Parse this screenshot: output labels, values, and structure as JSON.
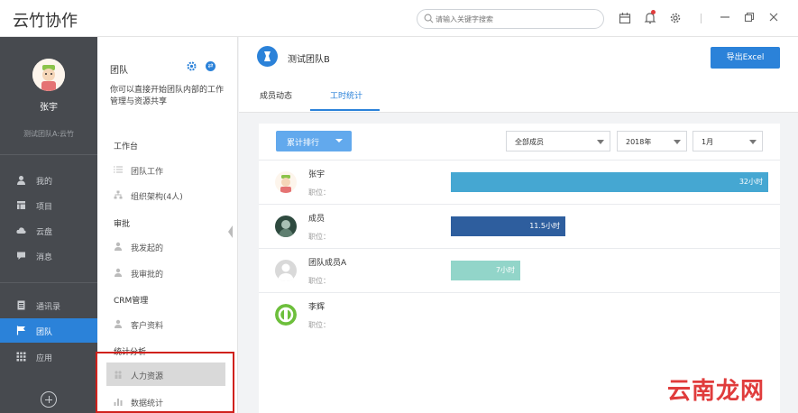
{
  "app": {
    "title": "云竹协作"
  },
  "search": {
    "placeholder": "请输入关键字搜索"
  },
  "sidebar": {
    "user_name": "张宇",
    "org_name": "测试团队A:云竹",
    "items": [
      {
        "label": "我的",
        "icon": "user-icon"
      },
      {
        "label": "项目",
        "icon": "project-icon"
      },
      {
        "label": "云盘",
        "icon": "cloud-icon"
      },
      {
        "label": "消息",
        "icon": "message-icon"
      },
      {
        "label": "通讯录",
        "icon": "contacts-icon"
      },
      {
        "label": "团队",
        "icon": "flag-icon"
      },
      {
        "label": "应用",
        "icon": "apps-grid-icon"
      }
    ]
  },
  "panel": {
    "title": "团队",
    "description": "你可以直接开始团队内部的工作管理与资源共享",
    "sections": {
      "workbench": "工作台",
      "approval": "审批",
      "crm": "CRM管理",
      "stats": "统计分析"
    },
    "items": {
      "team_work": "团队工作",
      "org": "组织架构(4人)",
      "initiated": "我发起的",
      "approved": "我审批的",
      "customers": "客户资料",
      "hr": "人力资源",
      "data_stats": "数据统计"
    }
  },
  "main": {
    "team_name": "测试团队B",
    "export_label": "导出Excel",
    "tabs": [
      "成员动态",
      "工时统计"
    ],
    "active_tab": "工时统计",
    "rank_button": "累计排行",
    "filters": {
      "members": "全部成员",
      "year": "2018年",
      "month": "1月"
    },
    "position_label": "职位："
  },
  "chart_data": {
    "type": "bar",
    "orientation": "horizontal",
    "categories": [
      "张宇",
      "成员",
      "团队成员A",
      "李辉"
    ],
    "values": [
      32,
      11.5,
      7,
      0
    ],
    "value_labels": [
      "32小时",
      "11.5小时",
      "7小时",
      ""
    ],
    "unit": "小时",
    "colors": [
      "#45a7d2",
      "#2e5e9e",
      "#92d5c9",
      "#cccccc"
    ]
  },
  "watermark": "云南龙网"
}
